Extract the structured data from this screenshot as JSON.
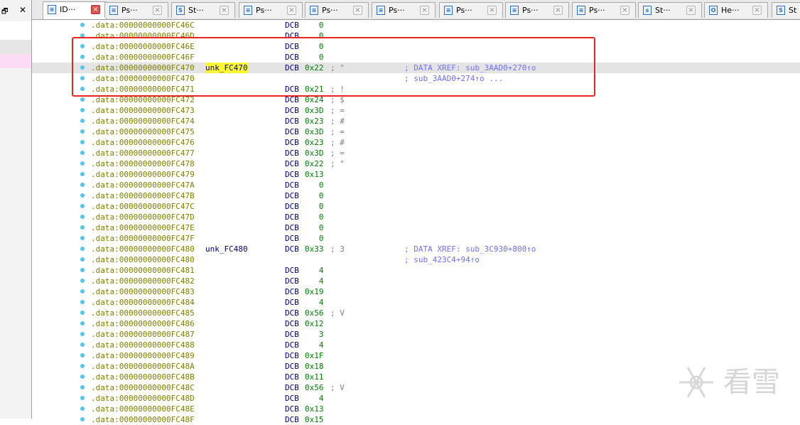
{
  "window": {
    "restore_glyph": "🗗",
    "close_glyph": "✕"
  },
  "tabs": [
    {
      "label": "ID···",
      "icon": "list-view-icon",
      "active": true
    },
    {
      "label": "Ps···",
      "icon": "list-view-icon"
    },
    {
      "label": "St···",
      "icon": "structures-icon"
    },
    {
      "label": "Ps···",
      "icon": "list-view-icon"
    },
    {
      "label": "Ps···",
      "icon": "list-view-icon"
    },
    {
      "label": "Ps···",
      "icon": "list-view-icon"
    },
    {
      "label": "Ps···",
      "icon": "list-view-icon"
    },
    {
      "label": "Ps···",
      "icon": "list-view-icon"
    },
    {
      "label": "Ps···",
      "icon": "list-view-icon"
    },
    {
      "label": "St···",
      "icon": "strings-icon"
    },
    {
      "label": "He···",
      "icon": "hex-view-icon"
    },
    {
      "label": "St",
      "icon": "structures-icon"
    }
  ],
  "tab_close_glyph": "×",
  "listing": [
    {
      "addr": ".data:00000000000FC46C",
      "mn": "DCB",
      "op": "   0"
    },
    {
      "addr": ".data:00000000000FC46D",
      "mn": "DCB",
      "op": "   0"
    },
    {
      "addr": ".data:00000000000FC46E",
      "mn": "DCB",
      "op": "   0"
    },
    {
      "addr": ".data:00000000000FC46F",
      "mn": "DCB",
      "op": "   0"
    },
    {
      "addr": ".data:00000000000FC470",
      "label": "unk_FC470",
      "mn": "DCB",
      "op": "0x22",
      "comment": "; \"",
      "xref": "; DATA XREF: sub_3AAD0+270↑o"
    },
    {
      "addr": ".data:00000000000FC470",
      "xref": "; sub_3AAD0+274↑o ..."
    },
    {
      "addr": ".data:00000000000FC471",
      "mn": "DCB",
      "op": "0x21",
      "comment": "; !"
    },
    {
      "addr": ".data:00000000000FC472",
      "mn": "DCB",
      "op": "0x24",
      "comment": "; $"
    },
    {
      "addr": ".data:00000000000FC473",
      "mn": "DCB",
      "op": "0x3D",
      "comment": "; ="
    },
    {
      "addr": ".data:00000000000FC474",
      "mn": "DCB",
      "op": "0x23",
      "comment": "; #"
    },
    {
      "addr": ".data:00000000000FC475",
      "mn": "DCB",
      "op": "0x3D",
      "comment": "; ="
    },
    {
      "addr": ".data:00000000000FC476",
      "mn": "DCB",
      "op": "0x23",
      "comment": "; #"
    },
    {
      "addr": ".data:00000000000FC477",
      "mn": "DCB",
      "op": "0x3D",
      "comment": "; ="
    },
    {
      "addr": ".data:00000000000FC478",
      "mn": "DCB",
      "op": "0x22",
      "comment": "; \""
    },
    {
      "addr": ".data:00000000000FC479",
      "mn": "DCB",
      "op": "0x13"
    },
    {
      "addr": ".data:00000000000FC47A",
      "mn": "DCB",
      "op": "   0"
    },
    {
      "addr": ".data:00000000000FC47B",
      "mn": "DCB",
      "op": "   0"
    },
    {
      "addr": ".data:00000000000FC47C",
      "mn": "DCB",
      "op": "   0"
    },
    {
      "addr": ".data:00000000000FC47D",
      "mn": "DCB",
      "op": "   0"
    },
    {
      "addr": ".data:00000000000FC47E",
      "mn": "DCB",
      "op": "   0"
    },
    {
      "addr": ".data:00000000000FC47F",
      "mn": "DCB",
      "op": "   0"
    },
    {
      "addr": ".data:00000000000FC480",
      "label": "unk_FC480",
      "mn": "DCB",
      "op": "0x33",
      "comment": "; 3",
      "xref": "; DATA XREF: sub_3C930+800↑o"
    },
    {
      "addr": ".data:00000000000FC480",
      "xref": "; sub_423C4+94↑o"
    },
    {
      "addr": ".data:00000000000FC481",
      "mn": "DCB",
      "op": "   4"
    },
    {
      "addr": ".data:00000000000FC482",
      "mn": "DCB",
      "op": "   4"
    },
    {
      "addr": ".data:00000000000FC483",
      "mn": "DCB",
      "op": "0x19"
    },
    {
      "addr": ".data:00000000000FC484",
      "mn": "DCB",
      "op": "   4"
    },
    {
      "addr": ".data:00000000000FC485",
      "mn": "DCB",
      "op": "0x56",
      "comment": "; V"
    },
    {
      "addr": ".data:00000000000FC486",
      "mn": "DCB",
      "op": "0x12"
    },
    {
      "addr": ".data:00000000000FC487",
      "mn": "DCB",
      "op": "   3"
    },
    {
      "addr": ".data:00000000000FC488",
      "mn": "DCB",
      "op": "   4"
    },
    {
      "addr": ".data:00000000000FC489",
      "mn": "DCB",
      "op": "0x1F"
    },
    {
      "addr": ".data:00000000000FC48A",
      "mn": "DCB",
      "op": "0x18"
    },
    {
      "addr": ".data:00000000000FC48B",
      "mn": "DCB",
      "op": "0x11"
    },
    {
      "addr": ".data:00000000000FC48C",
      "mn": "DCB",
      "op": "0x56",
      "comment": "; V"
    },
    {
      "addr": ".data:00000000000FC48D",
      "mn": "DCB",
      "op": "   4"
    },
    {
      "addr": ".data:00000000000FC48E",
      "mn": "DCB",
      "op": "0x13"
    },
    {
      "addr": ".data:00000000000FC48F",
      "mn": "DCB",
      "op": "0x15"
    }
  ],
  "highlighted_row": 4,
  "highlighted_label_row": 4,
  "watermark": {
    "text": "看雪",
    "icon": "snowflake-logo"
  },
  "colors": {
    "address": "#808000",
    "mnemonic": "#000080",
    "operand": "#008000",
    "xref": "#7070ff",
    "red_box": "#e8261f",
    "label_highlight": "#ffff33",
    "dot": "#4fc7f0"
  }
}
